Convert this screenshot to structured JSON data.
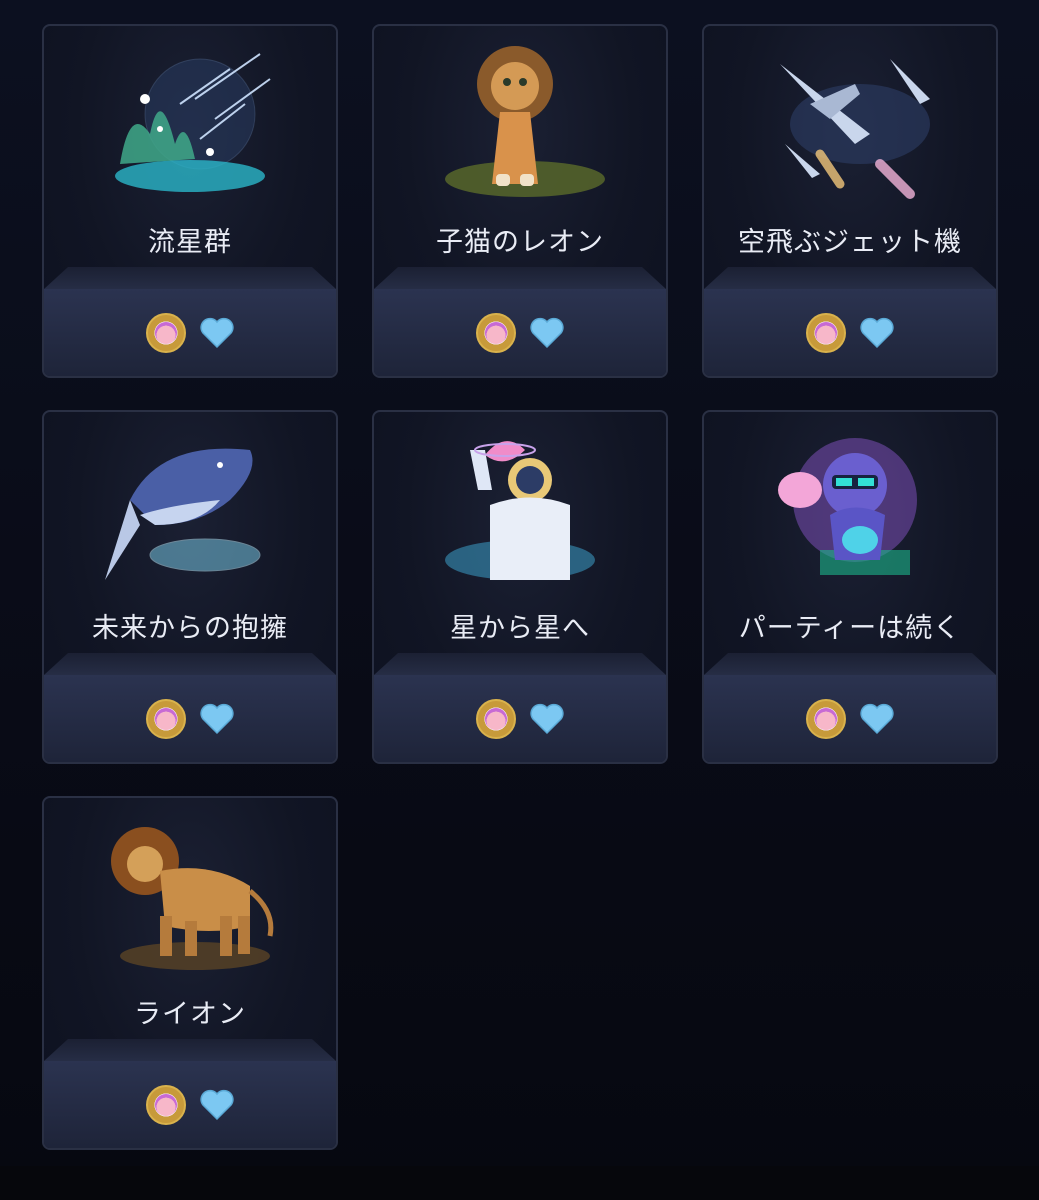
{
  "colors": {
    "heart": "#7cc8f2",
    "card_border": "#2a3044",
    "footer": "#2b3350",
    "text": "#e9ecf5"
  },
  "gifts": [
    {
      "name": "流星群",
      "art_icon": "meteor-shower-icon"
    },
    {
      "name": "子猫のレオン",
      "art_icon": "lion-cub-icon"
    },
    {
      "name": "空飛ぶジェット機",
      "art_icon": "jets-icon"
    },
    {
      "name": "未来からの抱擁",
      "art_icon": "whale-icon"
    },
    {
      "name": "星から星へ",
      "art_icon": "astronaut-icon"
    },
    {
      "name": "パーティーは続く",
      "art_icon": "party-cat-icon"
    },
    {
      "name": "ライオン",
      "art_icon": "lion-icon"
    }
  ]
}
